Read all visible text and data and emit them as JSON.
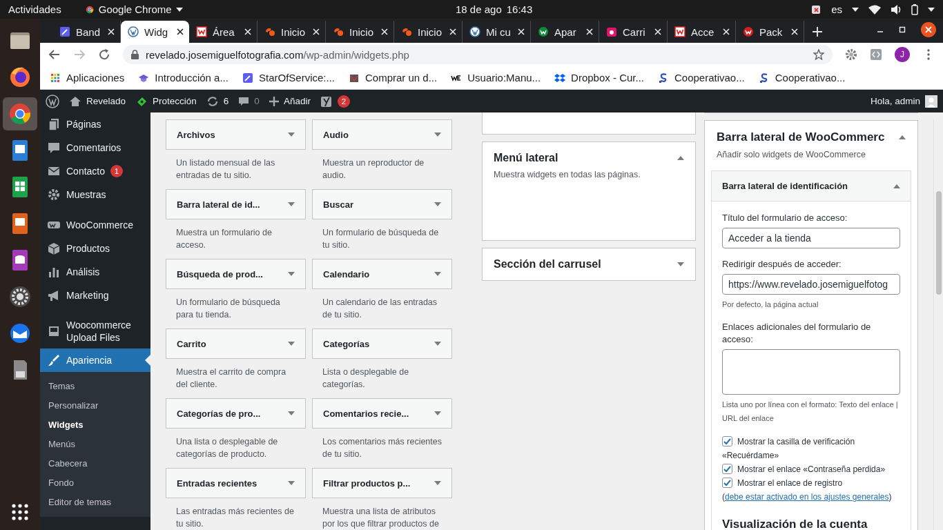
{
  "system_bar": {
    "activities": "Actividades",
    "app": "Google Chrome",
    "date": "18 de ago",
    "time": "16:43",
    "language": "es"
  },
  "dock": [
    {
      "kind": "files",
      "selected": false
    },
    {
      "kind": "firefox",
      "selected": false
    },
    {
      "kind": "chrome",
      "selected": true
    },
    {
      "kind": "writer",
      "selected": false
    },
    {
      "kind": "calc",
      "selected": false
    },
    {
      "kind": "impress",
      "selected": false
    },
    {
      "kind": "base",
      "selected": false
    },
    {
      "kind": "settings",
      "selected": false
    },
    {
      "kind": "mail",
      "selected": false
    },
    {
      "kind": "card",
      "selected": false
    }
  ],
  "tabs": [
    {
      "title": "Band",
      "kind": "tool",
      "selected": false
    },
    {
      "title": "Widg",
      "kind": "wordpress",
      "selected": true
    },
    {
      "title": "Área",
      "kind": "square-w",
      "selected": false
    },
    {
      "title": "Inicio",
      "kind": "cp",
      "selected": false
    },
    {
      "title": "Inicio",
      "kind": "cp",
      "selected": false
    },
    {
      "title": "Inicio",
      "kind": "cp",
      "selected": false
    },
    {
      "title": "Mi cu",
      "kind": "wordpress",
      "selected": false
    },
    {
      "title": "Apar",
      "kind": "green-w",
      "selected": false
    },
    {
      "title": "Carri",
      "kind": "fu",
      "selected": false
    },
    {
      "title": "Acce",
      "kind": "square-w",
      "selected": false
    },
    {
      "title": "Pack",
      "kind": "red-w",
      "selected": false
    }
  ],
  "address": {
    "host": "revelado.josemiguelfotografia.com",
    "path": "/wp-admin/widgets.php",
    "profile": "J"
  },
  "bookmarks": [
    {
      "title": "Aplicaciones",
      "kind": "apps"
    },
    {
      "title": "Introducción a...",
      "kind": "cap"
    },
    {
      "title": "StarOfService:...",
      "kind": "tool"
    },
    {
      "title": "Comprar un d...",
      "kind": "shop"
    },
    {
      "title": "Usuario:Manu...",
      "kind": "we"
    },
    {
      "title": "Dropbox - Cur...",
      "kind": "dropbox"
    },
    {
      "title": "Cooperativao...",
      "kind": "s"
    },
    {
      "title": "Cooperativao...",
      "kind": "s"
    }
  ],
  "admin_bar": {
    "site": "Revelado",
    "security": "Protección",
    "updates": "6",
    "comments": "0",
    "new": "Añadir",
    "seo_badge": "2",
    "greeting": "Hola, admin"
  },
  "menu": [
    [
      {
        "label": "Páginas",
        "kind": "pages",
        "selected": false
      },
      {
        "label": "Comentarios",
        "kind": "comments",
        "selected": false
      },
      {
        "label": "Contacto",
        "kind": "mail",
        "selected": false,
        "badge": "1"
      },
      {
        "label": "Muestras",
        "kind": "gear",
        "selected": false
      }
    ],
    [
      {
        "label": "WooCommerce",
        "kind": "woo",
        "selected": false
      },
      {
        "label": "Productos",
        "kind": "box",
        "selected": false
      },
      {
        "label": "Análisis",
        "kind": "chart",
        "selected": false
      },
      {
        "label": "Marketing",
        "kind": "megaphone",
        "selected": false
      }
    ],
    [
      {
        "label": "Woocommerce Upload Files",
        "kind": "upload",
        "selected": false
      },
      {
        "label": "Apariencia",
        "kind": "brush",
        "selected": true,
        "children": [
          {
            "label": "Temas",
            "selected": false
          },
          {
            "label": "Personalizar",
            "selected": false
          },
          {
            "label": "Widgets",
            "selected": true
          },
          {
            "label": "Menús",
            "selected": false
          },
          {
            "label": "Cabecera",
            "selected": false
          },
          {
            "label": "Fondo",
            "selected": false
          },
          {
            "label": "Editor de temas",
            "selected": false
          }
        ]
      }
    ]
  ],
  "widgets": [
    {
      "title": "Archivos",
      "description": "Un listado mensual de las entradas de tu sitio."
    },
    {
      "title": "Audio",
      "description": "Muestra un reproductor de audio."
    },
    {
      "title": "Barra lateral de id...",
      "description": "Muestra un formulario de acceso."
    },
    {
      "title": "Buscar",
      "description": "Un formulario de búsqueda de tu sitio."
    },
    {
      "title": "Búsqueda de prod...",
      "description": "Un formulario de búsqueda para tu tienda."
    },
    {
      "title": "Calendario",
      "description": "Un calendario de las entradas de tu sitio."
    },
    {
      "title": "Carrito",
      "description": "Muestra el carrito de compra del cliente."
    },
    {
      "title": "Categorías",
      "description": "Lista o desplegable de categorías."
    },
    {
      "title": "Categorías de pro...",
      "description": "Una lista o desplegable de categorías de producto."
    },
    {
      "title": "Comentarios recie...",
      "description": "Los comentarios más recientes de tu sitio."
    },
    {
      "title": "Entradas recientes",
      "description": "Las entradas más recientes de tu sitio."
    },
    {
      "title": "Filtrar productos p...",
      "description": "Muestra una lista de atributos por los que filtrar productos de"
    }
  ],
  "areas": [
    {
      "title": "Menú lateral",
      "description": "Muestra widgets en todas las páginas.",
      "expanded": true
    },
    {
      "title": "Sección del carrusel",
      "expanded": false
    }
  ],
  "woo_area": {
    "title": "Barra lateral de WooCommerc",
    "description": "Añadir solo widgets de WooCommerce",
    "expanded": true,
    "widget": {
      "title": "Barra lateral de identificación",
      "expanded": true,
      "fields": [
        {
          "label": "Título del formulario de acceso:",
          "value": "Acceder a la tienda"
        },
        {
          "label": "Redirigir después de acceder:",
          "value": "https://www.revelado.josemiguelfotog",
          "hint": "Por defecto, la página actual"
        }
      ],
      "links_field": {
        "label": "Enlaces adicionales del formulario de acceso:",
        "hint": "Lista uno por línea con el formato: Texto del enlace | URL del enlace"
      },
      "options": [
        {
          "label": "Mostrar la casilla de verificación «Recuérdame»",
          "checked": true
        },
        {
          "label": "Mostrar el enlace «Contraseña perdida»",
          "checked": true
        },
        {
          "label": "Mostrar el enlace de registro (",
          "link": "debe estar activado en los ajustes generales",
          "after": ")",
          "checked": true
        }
      ],
      "section": "Visualización de la cuenta"
    }
  }
}
